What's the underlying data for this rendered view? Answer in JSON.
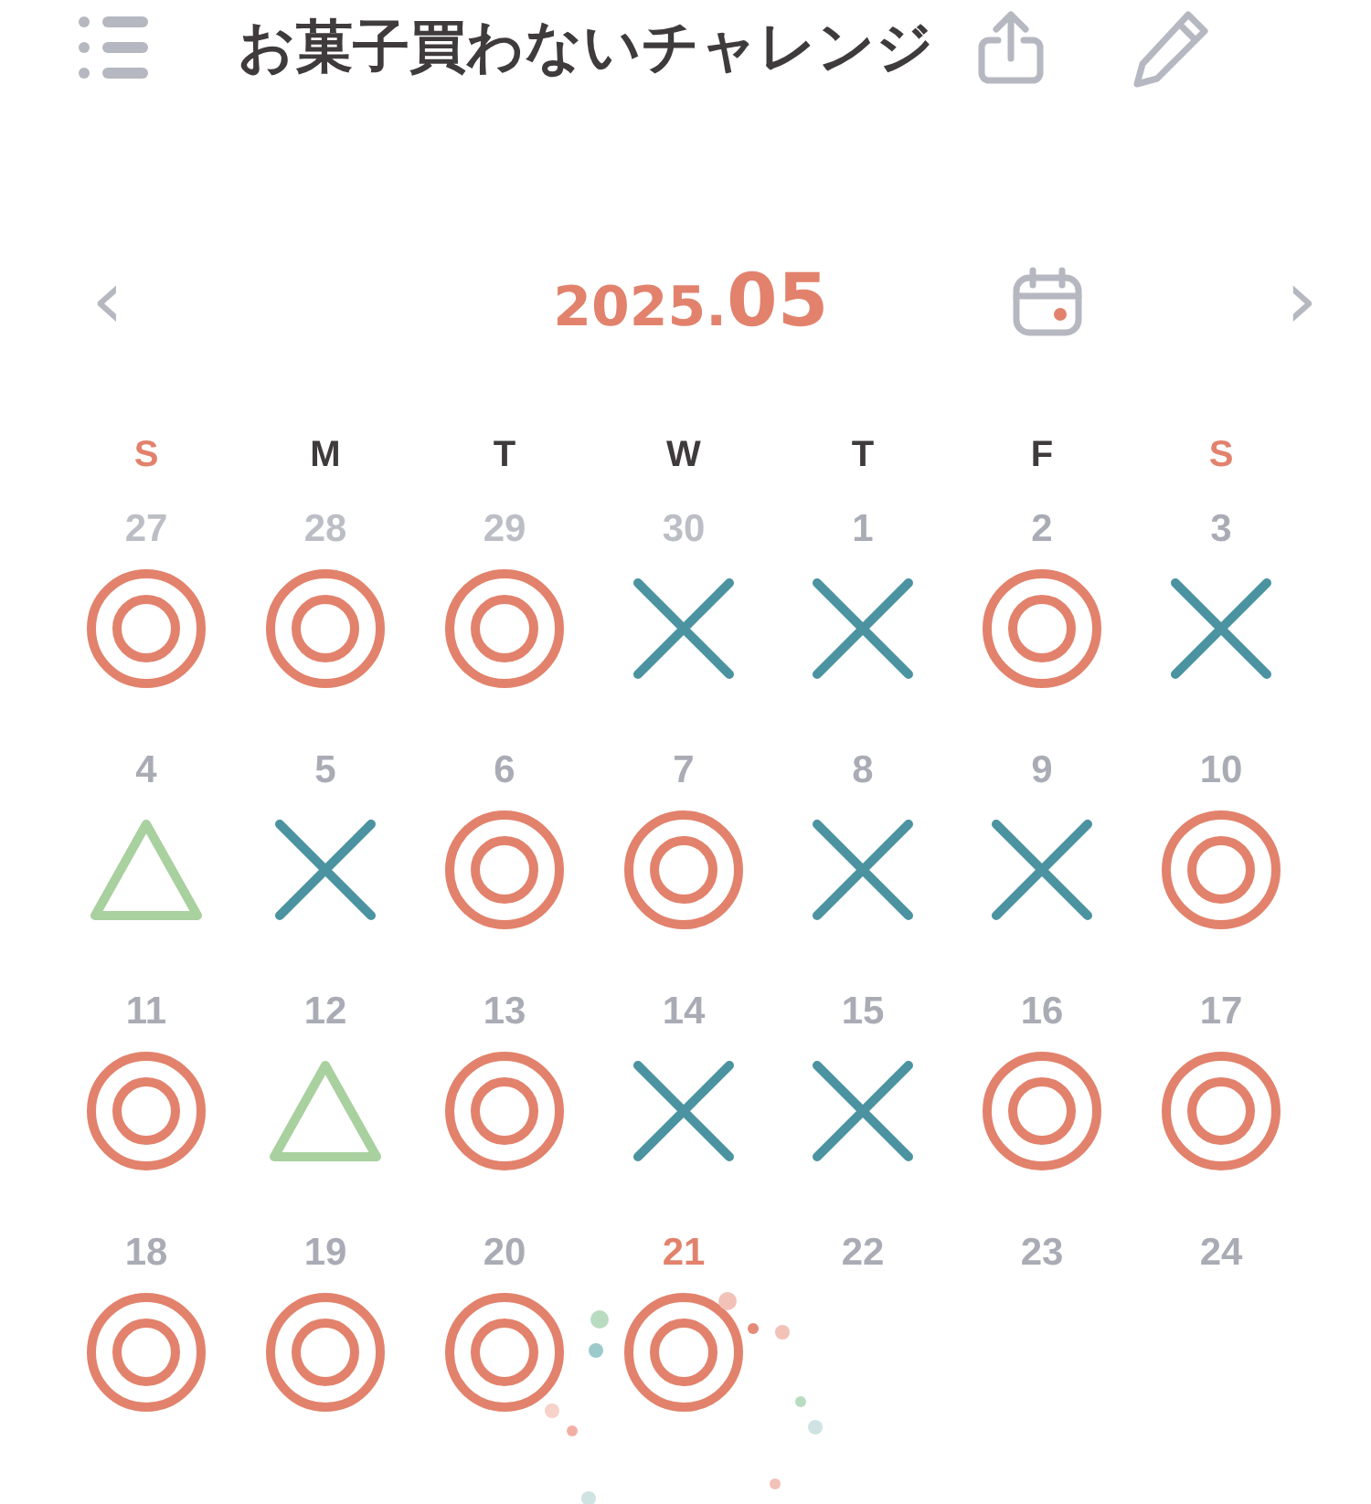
{
  "header": {
    "title": "お菓子買わないチャレンジ"
  },
  "month_nav": {
    "prev": "‹",
    "year": "2025.",
    "month": "05",
    "next": "›"
  },
  "weekdays": [
    {
      "label": "S",
      "weekend": true
    },
    {
      "label": "M",
      "weekend": false
    },
    {
      "label": "T",
      "weekend": false
    },
    {
      "label": "W",
      "weekend": false
    },
    {
      "label": "T",
      "weekend": false
    },
    {
      "label": "F",
      "weekend": false
    },
    {
      "label": "S",
      "weekend": true
    }
  ],
  "days": [
    {
      "day": "27",
      "outside": true,
      "today": false,
      "kind": "double-circle"
    },
    {
      "day": "28",
      "outside": true,
      "today": false,
      "kind": "double-circle"
    },
    {
      "day": "29",
      "outside": true,
      "today": false,
      "kind": "double-circle"
    },
    {
      "day": "30",
      "outside": true,
      "today": false,
      "kind": "cross"
    },
    {
      "day": "1",
      "outside": false,
      "today": false,
      "kind": "cross"
    },
    {
      "day": "2",
      "outside": false,
      "today": false,
      "kind": "double-circle"
    },
    {
      "day": "3",
      "outside": false,
      "today": false,
      "kind": "cross"
    },
    {
      "day": "4",
      "outside": false,
      "today": false,
      "kind": "triangle"
    },
    {
      "day": "5",
      "outside": false,
      "today": false,
      "kind": "cross"
    },
    {
      "day": "6",
      "outside": false,
      "today": false,
      "kind": "double-circle"
    },
    {
      "day": "7",
      "outside": false,
      "today": false,
      "kind": "double-circle"
    },
    {
      "day": "8",
      "outside": false,
      "today": false,
      "kind": "cross"
    },
    {
      "day": "9",
      "outside": false,
      "today": false,
      "kind": "cross"
    },
    {
      "day": "10",
      "outside": false,
      "today": false,
      "kind": "double-circle"
    },
    {
      "day": "11",
      "outside": false,
      "today": false,
      "kind": "double-circle"
    },
    {
      "day": "12",
      "outside": false,
      "today": false,
      "kind": "triangle"
    },
    {
      "day": "13",
      "outside": false,
      "today": false,
      "kind": "double-circle"
    },
    {
      "day": "14",
      "outside": false,
      "today": false,
      "kind": "cross"
    },
    {
      "day": "15",
      "outside": false,
      "today": false,
      "kind": "cross"
    },
    {
      "day": "16",
      "outside": false,
      "today": false,
      "kind": "double-circle"
    },
    {
      "day": "17",
      "outside": false,
      "today": false,
      "kind": "double-circle"
    },
    {
      "day": "18",
      "outside": false,
      "today": false,
      "kind": "double-circle"
    },
    {
      "day": "19",
      "outside": false,
      "today": false,
      "kind": "double-circle"
    },
    {
      "day": "20",
      "outside": false,
      "today": false,
      "kind": "double-circle"
    },
    {
      "day": "21",
      "outside": false,
      "today": true,
      "kind": "double-circle"
    },
    {
      "day": "22",
      "outside": false,
      "today": false,
      "kind": "none"
    },
    {
      "day": "23",
      "outside": false,
      "today": false,
      "kind": "none"
    },
    {
      "day": "24",
      "outside": false,
      "today": false,
      "kind": "none"
    }
  ]
}
